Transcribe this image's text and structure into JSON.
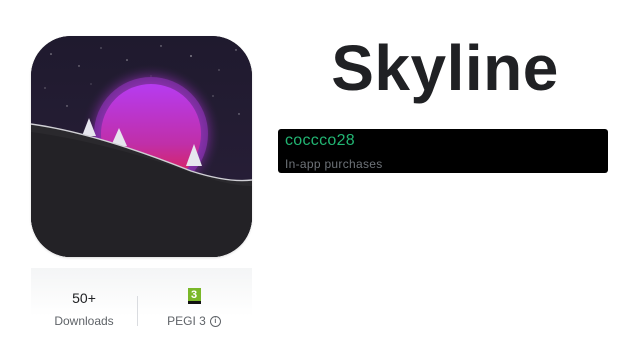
{
  "app": {
    "title": "Skyline",
    "developer": "coccco28",
    "subtitle": "In-app purchases"
  },
  "stats": {
    "downloads_value": "50+",
    "downloads_label": "Downloads",
    "rating_badge": "3",
    "rating_label": "PEGI 3",
    "info_glyph": "i"
  },
  "colors": {
    "developer_text": "#22b573",
    "developer_box": "#000000",
    "pegi_green": "#7ab829"
  },
  "icons": {
    "app_icon": "skyline-sunset-icon",
    "info": "info-icon",
    "pegi": "pegi-3-badge"
  }
}
